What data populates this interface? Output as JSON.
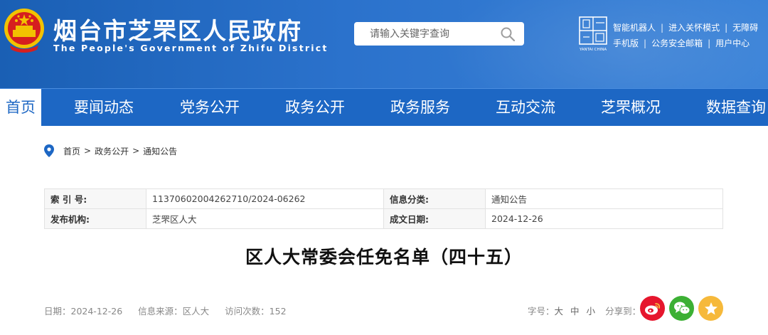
{
  "header": {
    "title": "烟台市芝罘区人民政府",
    "subtitle": "The People's Government of Zhifu District",
    "search_placeholder": "请输入关键字查询",
    "city_logo_text": "YANTAI CHINA",
    "links_row1": [
      "智能机器人",
      "进入关怀模式",
      "无障碍"
    ],
    "links_row2": [
      "手机版",
      "公务安全邮箱",
      "用户中心"
    ]
  },
  "nav": {
    "items": [
      "首页",
      "要闻动态",
      "党务公开",
      "政务公开",
      "政务服务",
      "互动交流",
      "芝罘概况",
      "数据查询"
    ],
    "active": 0
  },
  "breadcrumb": [
    "首页",
    "政务公开",
    "通知公告"
  ],
  "info": {
    "index_label": "索 引 号:",
    "index_value": "11370602004262710/2024-06262",
    "category_label": "信息分类:",
    "category_value": "通知公告",
    "publisher_label": "发布机构:",
    "publisher_value": "芝罘区人大",
    "date_label": "成文日期:",
    "date_value": "2024-12-26"
  },
  "article": {
    "title": "区人大常委会任免名单（四十五）",
    "meta_date": "日期：2024-12-26",
    "meta_source": "信息来源：区人大",
    "meta_views": "访问次数：152"
  },
  "tools": {
    "font_label": "字号：",
    "font_large": "大",
    "font_medium": "中",
    "font_small": "小",
    "share_label": "分享到："
  },
  "colors": {
    "header_blue": "#2b72cc",
    "nav_blue": "#1d67c4",
    "weibo_red": "#e6162d",
    "wechat_green": "#3cb034",
    "favorite_gold": "#f6b93b"
  }
}
